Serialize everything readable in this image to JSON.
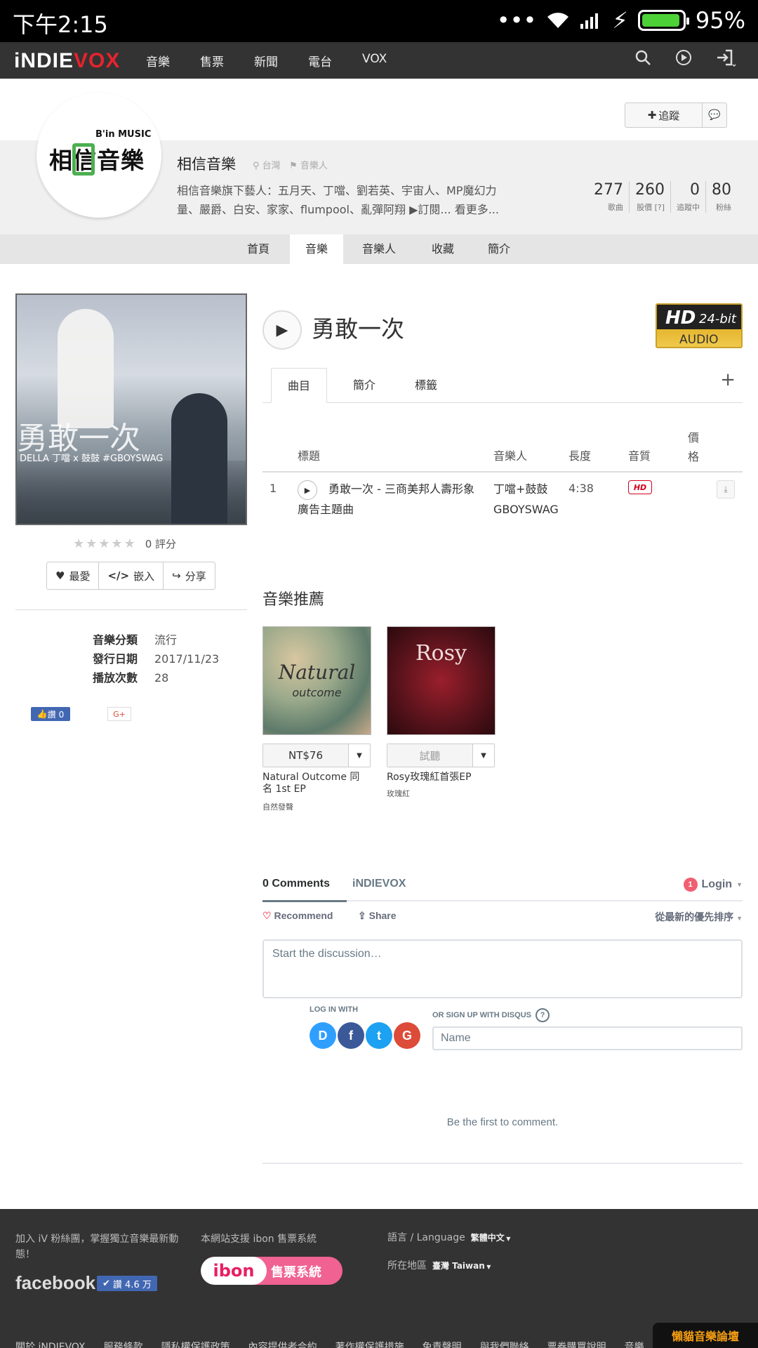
{
  "status_bar": {
    "time": "下午2:15",
    "battery_percent": "95%",
    "battery_level": 0.95
  },
  "topnav": {
    "logo_a": "iNDIE",
    "logo_b": "VOX",
    "links": [
      "音樂",
      "售票",
      "新聞",
      "電台",
      "VOX"
    ],
    "icons": [
      "search-icon",
      "play-circle-icon",
      "login-icon"
    ]
  },
  "profile": {
    "follow_label": "追蹤",
    "logo_big": "相信音樂",
    "logo_small": "B'in MUSIC",
    "name": "相信音樂",
    "location": "台灣",
    "role": "音樂人",
    "description": "相信音樂旗下藝人：五月天、丁噹、劉若英、宇宙人、MP魔幻力量、嚴爵、白安、家家、flumpool、亂彈阿翔 ▶訂閱... 看更多...",
    "stats": [
      {
        "value": "277",
        "label": "歌曲"
      },
      {
        "value": "260",
        "label": "股價 [?]"
      },
      {
        "value": "0",
        "label": "追蹤中"
      },
      {
        "value": "80",
        "label": "粉絲"
      }
    ],
    "tabs": [
      "首頁",
      "音樂",
      "音樂人",
      "收藏",
      "簡介"
    ],
    "active_tab": "音樂"
  },
  "album": {
    "title": "勇敢一次",
    "cover_title": "勇敢一次",
    "cover_sub": "DELLA 丁噹 x 鼓鼓 #GBOYSWAG",
    "rating_score": "0 評分",
    "stars": 0,
    "actions": [
      "最愛",
      "嵌入",
      "分享"
    ],
    "info": [
      {
        "key": "音樂分類",
        "value": "流行"
      },
      {
        "key": "發行日期",
        "value": "2017/11/23"
      },
      {
        "key": "播放次數",
        "value": "28"
      }
    ],
    "fb_like": "讚 0",
    "gplus": "G+",
    "hd_badge": {
      "hd": "HD",
      "bit": "24-bit",
      "audio": "AUDIO"
    },
    "subtabs": [
      "曲目",
      "簡介",
      "標籤"
    ],
    "add": "+"
  },
  "tracklist": {
    "headers": {
      "title": "標題",
      "artist": "音樂人",
      "length": "長度",
      "quality": "音質",
      "price": "價格"
    },
    "rows": [
      {
        "num": "1",
        "title": "勇敢一次 - 三商美邦人壽形象廣告主題曲",
        "artist": "丁噹+鼓鼓 GBOYSWAG",
        "length": "4:38",
        "quality": "HD"
      }
    ]
  },
  "recommend": {
    "title": "音樂推薦",
    "items": [
      {
        "cover_text": "Natural",
        "cover_text2": "outcome",
        "button": "NT$76",
        "name": "Natural Outcome 同名 1st EP",
        "artist": "自然發聲"
      },
      {
        "cover_text": "Rosy",
        "button": "試聽",
        "name": "Rosy玫瑰紅首張EP",
        "artist": "玫瑰紅"
      }
    ]
  },
  "disqus": {
    "comments": "0 Comments",
    "site": "iNDIEVOX",
    "login": "Login",
    "notif": "1",
    "recommend": "Recommend",
    "share": "Share",
    "sort": "從最新的優先排序",
    "placeholder": "Start the discussion…",
    "login_with": "LOG IN WITH",
    "signup": "OR SIGN UP WITH DISQUS",
    "name_placeholder": "Name",
    "first": "Be the first to comment.",
    "social": [
      {
        "letter": "D",
        "color": "#2e9fff"
      },
      {
        "letter": "f",
        "color": "#3b5998"
      },
      {
        "letter": "t",
        "color": "#1da1f2"
      },
      {
        "letter": "G",
        "color": "#dd4b39"
      }
    ]
  },
  "footer": {
    "join": "加入 iV 粉絲團，掌握獨立音樂最新動態！",
    "facebook": "facebook",
    "fb_like": "讚 4.6 万",
    "ibon_text": "本網站支援 ibon 售票系統",
    "ibon_word": "ibon",
    "ibon_pill": "售票系統",
    "lang_label": "語言 / Language",
    "lang_value": "繁體中文",
    "region_label": "所在地區",
    "region_value": "臺灣 Taiwan",
    "links": [
      "關於 iNDIEVOX",
      "服務條款",
      "隱私權保護政策",
      "內容提供者合約",
      "著作權保護措施",
      "免責聲明",
      "與我們聯絡",
      "票券購買說明",
      "音樂..."
    ],
    "watermark": "懶貓音樂論壇"
  }
}
